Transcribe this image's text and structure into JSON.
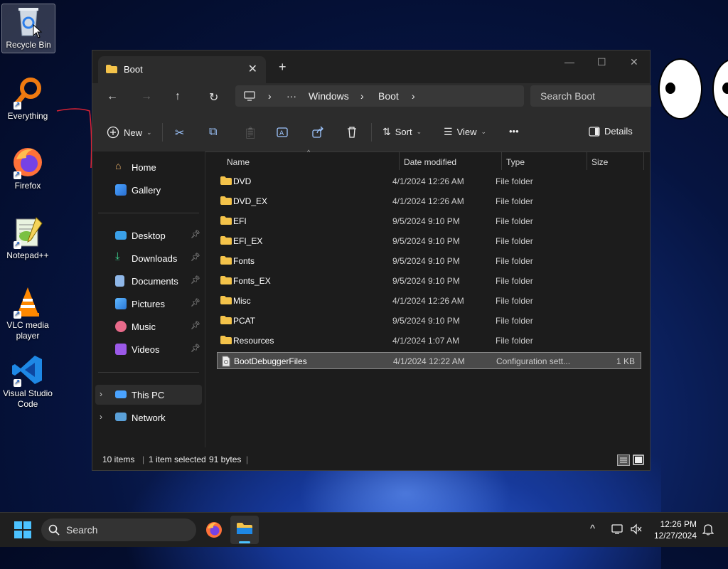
{
  "desktop": {
    "icons": [
      {
        "label": "Recycle Bin"
      },
      {
        "label": "Everything"
      },
      {
        "label": "Firefox"
      },
      {
        "label": "Notepad++"
      },
      {
        "label": "VLC media player"
      },
      {
        "label": "Visual Studio Code"
      }
    ]
  },
  "window": {
    "tab_title": "Boot",
    "tab_close_glyph": "✕",
    "new_tab_glyph": "+",
    "controls": {
      "minimize": "—",
      "maximize": "☐",
      "close": "✕"
    },
    "nav": {
      "back": "←",
      "forward": "→",
      "up": "↑",
      "refresh": "↻"
    },
    "breadcrumb": {
      "more": "···",
      "items": [
        "Windows",
        "Boot"
      ],
      "sep": "›"
    },
    "search_placeholder": "Search Boot",
    "commands": {
      "new": "New",
      "sort": "Sort",
      "view": "View",
      "more": "•••",
      "details": "Details"
    },
    "sidebar": {
      "home": "Home",
      "gallery": "Gallery",
      "pinned": [
        "Desktop",
        "Downloads",
        "Documents",
        "Pictures",
        "Music",
        "Videos"
      ],
      "this_pc": "This PC",
      "network": "Network"
    },
    "columns": {
      "name": "Name",
      "date": "Date modified",
      "type": "Type",
      "size": "Size"
    },
    "files": [
      {
        "name": "DVD",
        "date": "4/1/2024 12:26 AM",
        "type": "File folder",
        "size": ""
      },
      {
        "name": "DVD_EX",
        "date": "4/1/2024 12:26 AM",
        "type": "File folder",
        "size": ""
      },
      {
        "name": "EFI",
        "date": "9/5/2024 9:10 PM",
        "type": "File folder",
        "size": ""
      },
      {
        "name": "EFI_EX",
        "date": "9/5/2024 9:10 PM",
        "type": "File folder",
        "size": ""
      },
      {
        "name": "Fonts",
        "date": "9/5/2024 9:10 PM",
        "type": "File folder",
        "size": ""
      },
      {
        "name": "Fonts_EX",
        "date": "9/5/2024 9:10 PM",
        "type": "File folder",
        "size": ""
      },
      {
        "name": "Misc",
        "date": "4/1/2024 12:26 AM",
        "type": "File folder",
        "size": ""
      },
      {
        "name": "PCAT",
        "date": "9/5/2024 9:10 PM",
        "type": "File folder",
        "size": ""
      },
      {
        "name": "Resources",
        "date": "4/1/2024 1:07 AM",
        "type": "File folder",
        "size": ""
      },
      {
        "name": "BootDebuggerFiles",
        "date": "4/1/2024 12:22 AM",
        "type": "Configuration sett...",
        "size": "1 KB",
        "selected": true
      }
    ],
    "status": {
      "count": "10 items",
      "selected": "1 item selected",
      "bytes": "91 bytes"
    }
  },
  "taskbar": {
    "search_label": "Search",
    "time": "12:26 PM",
    "date": "12/27/2024"
  },
  "colors": {
    "accent": "#4cc2ff",
    "folder": "#f4c34a",
    "selection": "#4a4a4a"
  }
}
